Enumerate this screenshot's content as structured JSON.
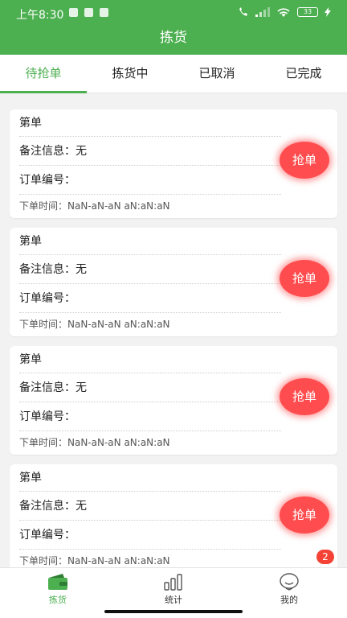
{
  "status": {
    "time": "上午8:30",
    "battery": "33"
  },
  "title": "拣货",
  "tabs": [
    {
      "label": "待抢单",
      "active": true
    },
    {
      "label": "拣货中",
      "active": false
    },
    {
      "label": "已取消",
      "active": false
    },
    {
      "label": "已完成",
      "active": false
    }
  ],
  "orders": [
    {
      "header": "第单",
      "remark": "备注信息：无",
      "order_no": "订单编号：",
      "time": "下单时间：NaN-aN-aN aN:aN:aN",
      "button": "抢单"
    },
    {
      "header": "第单",
      "remark": "备注信息：无",
      "order_no": "订单编号：",
      "time": "下单时间：NaN-aN-aN aN:aN:aN",
      "button": "抢单"
    },
    {
      "header": "第单",
      "remark": "备注信息：无",
      "order_no": "订单编号：",
      "time": "下单时间：NaN-aN-aN aN:aN:aN",
      "button": "抢单"
    },
    {
      "header": "第单",
      "remark": "备注信息：无",
      "order_no": "订单编号：",
      "time": "下单时间：NaN-aN-aN aN:aN:aN",
      "button": "抢单"
    }
  ],
  "badge": "2",
  "nav": [
    {
      "label": "拣货",
      "icon": "wallet-icon",
      "active": true
    },
    {
      "label": "统计",
      "icon": "bar-chart-icon",
      "active": false
    },
    {
      "label": "我的",
      "icon": "face-icon",
      "active": false
    }
  ],
  "colors": {
    "primary": "#4caf50",
    "grab": "#ff4d4f",
    "badge": "#f44336"
  }
}
